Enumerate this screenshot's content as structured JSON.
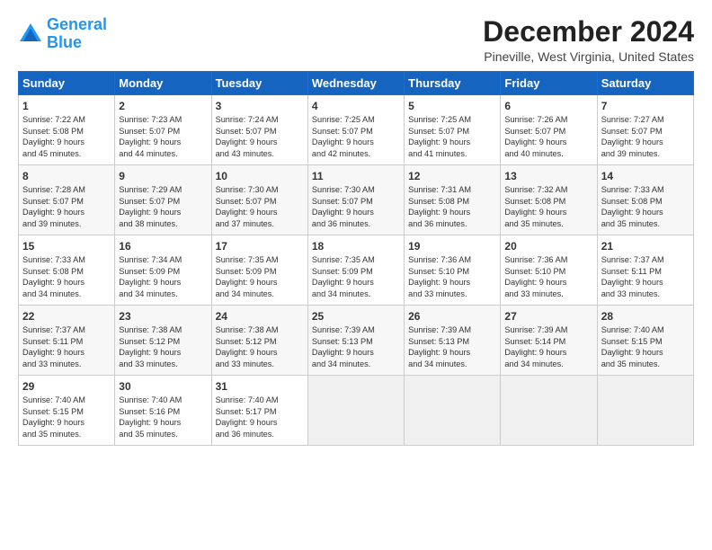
{
  "logo": {
    "line1": "General",
    "line2": "Blue"
  },
  "title": "December 2024",
  "location": "Pineville, West Virginia, United States",
  "days_of_week": [
    "Sunday",
    "Monday",
    "Tuesday",
    "Wednesday",
    "Thursday",
    "Friday",
    "Saturday"
  ],
  "weeks": [
    [
      {
        "day": "1",
        "info": "Sunrise: 7:22 AM\nSunset: 5:08 PM\nDaylight: 9 hours\nand 45 minutes."
      },
      {
        "day": "2",
        "info": "Sunrise: 7:23 AM\nSunset: 5:07 PM\nDaylight: 9 hours\nand 44 minutes."
      },
      {
        "day": "3",
        "info": "Sunrise: 7:24 AM\nSunset: 5:07 PM\nDaylight: 9 hours\nand 43 minutes."
      },
      {
        "day": "4",
        "info": "Sunrise: 7:25 AM\nSunset: 5:07 PM\nDaylight: 9 hours\nand 42 minutes."
      },
      {
        "day": "5",
        "info": "Sunrise: 7:25 AM\nSunset: 5:07 PM\nDaylight: 9 hours\nand 41 minutes."
      },
      {
        "day": "6",
        "info": "Sunrise: 7:26 AM\nSunset: 5:07 PM\nDaylight: 9 hours\nand 40 minutes."
      },
      {
        "day": "7",
        "info": "Sunrise: 7:27 AM\nSunset: 5:07 PM\nDaylight: 9 hours\nand 39 minutes."
      }
    ],
    [
      {
        "day": "8",
        "info": "Sunrise: 7:28 AM\nSunset: 5:07 PM\nDaylight: 9 hours\nand 39 minutes."
      },
      {
        "day": "9",
        "info": "Sunrise: 7:29 AM\nSunset: 5:07 PM\nDaylight: 9 hours\nand 38 minutes."
      },
      {
        "day": "10",
        "info": "Sunrise: 7:30 AM\nSunset: 5:07 PM\nDaylight: 9 hours\nand 37 minutes."
      },
      {
        "day": "11",
        "info": "Sunrise: 7:30 AM\nSunset: 5:07 PM\nDaylight: 9 hours\nand 36 minutes."
      },
      {
        "day": "12",
        "info": "Sunrise: 7:31 AM\nSunset: 5:08 PM\nDaylight: 9 hours\nand 36 minutes."
      },
      {
        "day": "13",
        "info": "Sunrise: 7:32 AM\nSunset: 5:08 PM\nDaylight: 9 hours\nand 35 minutes."
      },
      {
        "day": "14",
        "info": "Sunrise: 7:33 AM\nSunset: 5:08 PM\nDaylight: 9 hours\nand 35 minutes."
      }
    ],
    [
      {
        "day": "15",
        "info": "Sunrise: 7:33 AM\nSunset: 5:08 PM\nDaylight: 9 hours\nand 34 minutes."
      },
      {
        "day": "16",
        "info": "Sunrise: 7:34 AM\nSunset: 5:09 PM\nDaylight: 9 hours\nand 34 minutes."
      },
      {
        "day": "17",
        "info": "Sunrise: 7:35 AM\nSunset: 5:09 PM\nDaylight: 9 hours\nand 34 minutes."
      },
      {
        "day": "18",
        "info": "Sunrise: 7:35 AM\nSunset: 5:09 PM\nDaylight: 9 hours\nand 34 minutes."
      },
      {
        "day": "19",
        "info": "Sunrise: 7:36 AM\nSunset: 5:10 PM\nDaylight: 9 hours\nand 33 minutes."
      },
      {
        "day": "20",
        "info": "Sunrise: 7:36 AM\nSunset: 5:10 PM\nDaylight: 9 hours\nand 33 minutes."
      },
      {
        "day": "21",
        "info": "Sunrise: 7:37 AM\nSunset: 5:11 PM\nDaylight: 9 hours\nand 33 minutes."
      }
    ],
    [
      {
        "day": "22",
        "info": "Sunrise: 7:37 AM\nSunset: 5:11 PM\nDaylight: 9 hours\nand 33 minutes."
      },
      {
        "day": "23",
        "info": "Sunrise: 7:38 AM\nSunset: 5:12 PM\nDaylight: 9 hours\nand 33 minutes."
      },
      {
        "day": "24",
        "info": "Sunrise: 7:38 AM\nSunset: 5:12 PM\nDaylight: 9 hours\nand 33 minutes."
      },
      {
        "day": "25",
        "info": "Sunrise: 7:39 AM\nSunset: 5:13 PM\nDaylight: 9 hours\nand 34 minutes."
      },
      {
        "day": "26",
        "info": "Sunrise: 7:39 AM\nSunset: 5:13 PM\nDaylight: 9 hours\nand 34 minutes."
      },
      {
        "day": "27",
        "info": "Sunrise: 7:39 AM\nSunset: 5:14 PM\nDaylight: 9 hours\nand 34 minutes."
      },
      {
        "day": "28",
        "info": "Sunrise: 7:40 AM\nSunset: 5:15 PM\nDaylight: 9 hours\nand 35 minutes."
      }
    ],
    [
      {
        "day": "29",
        "info": "Sunrise: 7:40 AM\nSunset: 5:15 PM\nDaylight: 9 hours\nand 35 minutes."
      },
      {
        "day": "30",
        "info": "Sunrise: 7:40 AM\nSunset: 5:16 PM\nDaylight: 9 hours\nand 35 minutes."
      },
      {
        "day": "31",
        "info": "Sunrise: 7:40 AM\nSunset: 5:17 PM\nDaylight: 9 hours\nand 36 minutes."
      },
      {
        "day": "",
        "info": ""
      },
      {
        "day": "",
        "info": ""
      },
      {
        "day": "",
        "info": ""
      },
      {
        "day": "",
        "info": ""
      }
    ]
  ]
}
